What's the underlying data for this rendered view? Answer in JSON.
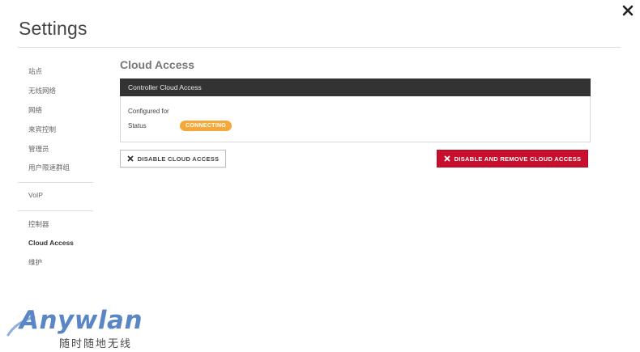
{
  "window": {
    "close_icon": "close-icon"
  },
  "page": {
    "title": "Settings"
  },
  "sidebar": {
    "items": [
      {
        "label": "站点"
      },
      {
        "label": "无线网络"
      },
      {
        "label": "网络"
      },
      {
        "label": "来宾控制"
      },
      {
        "label": "管理员"
      },
      {
        "label": "用户限速群组"
      },
      {
        "label": "VoIP"
      },
      {
        "label": "控制器"
      },
      {
        "label": "Cloud Access",
        "active": true
      },
      {
        "label": "维护"
      }
    ]
  },
  "main": {
    "section_title": "Cloud Access",
    "panel": {
      "header": "Controller Cloud Access",
      "configured_for_label": "Configured for",
      "configured_for_value": "",
      "status_label": "Status",
      "status_value": "CONNECTING",
      "status_color": "#f5a83a"
    },
    "buttons": {
      "disable": "DISABLE CLOUD ACCESS",
      "disable_remove": "DISABLE AND REMOVE CLOUD ACCESS",
      "danger_color": "#c8102e"
    }
  },
  "watermark": {
    "brand": "Anywlan",
    "tagline": "随时随地无线",
    "color": "#5b86c6"
  }
}
